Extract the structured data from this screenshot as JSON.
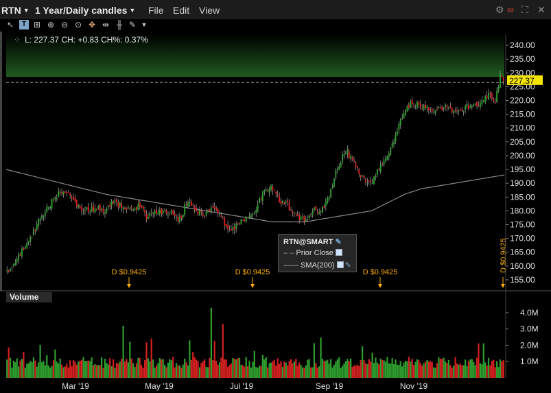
{
  "window": {
    "symbol": "RTN",
    "period": "1 Year/Daily candles",
    "menus": [
      "File",
      "Edit",
      "View"
    ]
  },
  "toolbar": {
    "icons": [
      "crosshair-icon",
      "text-tool-icon",
      "drawing-tool-icon",
      "zoom-in-icon",
      "zoom-out-icon",
      "pan-icon",
      "fit-icon",
      "split-icon",
      "bar-style-icon",
      "settings-icon"
    ]
  },
  "info": {
    "text": "L: 227.37 CH: +0.83 CH%: 0.37%"
  },
  "legend": {
    "title": "RTN@SMART",
    "items": [
      "Prior Close",
      "SMA(200)"
    ]
  },
  "volume_panel": {
    "label": "Volume"
  },
  "colors": {
    "up": "#2e9e2e",
    "down": "#d42020",
    "sma": "#8a8a8a",
    "last_price_bg": "#f2e300",
    "dividend": "#ffb000"
  },
  "chart_data": {
    "type": "candlestick",
    "price_axis": {
      "ticks": [
        "240.00",
        "235.00",
        "230.00",
        "225.00",
        "220.00",
        "215.00",
        "210.00",
        "205.00",
        "200.00",
        "195.00",
        "190.00",
        "185.00",
        "180.00",
        "175.00",
        "170.00",
        "165.00",
        "160.00",
        "155.00"
      ],
      "range": [
        151,
        244
      ]
    },
    "last_price": "227.37",
    "prior_close": 226.54,
    "volume_axis": {
      "ticks": [
        "4.0M",
        "3.0M",
        "2.0M",
        "1.0M"
      ],
      "range": [
        0,
        4500000
      ]
    },
    "x_labels": [
      "Mar '19",
      "May '19",
      "Jul '19",
      "Sep '19",
      "Nov '19"
    ],
    "dividends": [
      {
        "date": "Mar '19",
        "label": "D $0.9425"
      },
      {
        "date": "Jun '19",
        "label": "D $0.9425"
      },
      {
        "date": "Sep '19",
        "label": "D $0.9425"
      },
      {
        "date": "Dec '19",
        "label": "D $0.9425"
      }
    ],
    "close_trend": [
      [
        0,
        158
      ],
      [
        5,
        160
      ],
      [
        10,
        166
      ],
      [
        15,
        170
      ],
      [
        20,
        176
      ],
      [
        25,
        181
      ],
      [
        30,
        185
      ],
      [
        35,
        188
      ],
      [
        40,
        185
      ],
      [
        45,
        181
      ],
      [
        50,
        180
      ],
      [
        55,
        181
      ],
      [
        60,
        180
      ],
      [
        65,
        183
      ],
      [
        70,
        182
      ],
      [
        75,
        180
      ],
      [
        80,
        182
      ],
      [
        85,
        178
      ],
      [
        90,
        179
      ],
      [
        95,
        180
      ],
      [
        100,
        179
      ],
      [
        105,
        177
      ],
      [
        110,
        184
      ],
      [
        115,
        180
      ],
      [
        120,
        179
      ],
      [
        125,
        182
      ],
      [
        130,
        178
      ],
      [
        135,
        172
      ],
      [
        140,
        175
      ],
      [
        145,
        178
      ],
      [
        150,
        180
      ],
      [
        155,
        186
      ],
      [
        160,
        189
      ],
      [
        165,
        184
      ],
      [
        170,
        182
      ],
      [
        175,
        178
      ],
      [
        180,
        177
      ],
      [
        185,
        180
      ],
      [
        190,
        180
      ],
      [
        195,
        185
      ],
      [
        200,
        196
      ],
      [
        205,
        202
      ],
      [
        210,
        197
      ],
      [
        215,
        192
      ],
      [
        220,
        190
      ],
      [
        225,
        196
      ],
      [
        230,
        199
      ],
      [
        235,
        207
      ],
      [
        240,
        216
      ],
      [
        245,
        219
      ],
      [
        250,
        218
      ],
      [
        255,
        217
      ],
      [
        260,
        217
      ],
      [
        265,
        218
      ],
      [
        270,
        216
      ],
      [
        275,
        217
      ],
      [
        280,
        218
      ],
      [
        285,
        219
      ],
      [
        290,
        222
      ],
      [
        295,
        220
      ],
      [
        298,
        229
      ],
      [
        300,
        227.37
      ]
    ],
    "sma200": [
      [
        0,
        195
      ],
      [
        20,
        192
      ],
      [
        40,
        189
      ],
      [
        60,
        186
      ],
      [
        80,
        184
      ],
      [
        100,
        182
      ],
      [
        120,
        180
      ],
      [
        140,
        178
      ],
      [
        150,
        177
      ],
      [
        160,
        176
      ],
      [
        170,
        176
      ],
      [
        180,
        176
      ],
      [
        190,
        177
      ],
      [
        200,
        178
      ],
      [
        210,
        179
      ],
      [
        220,
        180
      ],
      [
        230,
        183
      ],
      [
        240,
        186
      ],
      [
        250,
        188
      ],
      [
        260,
        189
      ],
      [
        270,
        190
      ],
      [
        280,
        191
      ],
      [
        300,
        193
      ]
    ]
  }
}
